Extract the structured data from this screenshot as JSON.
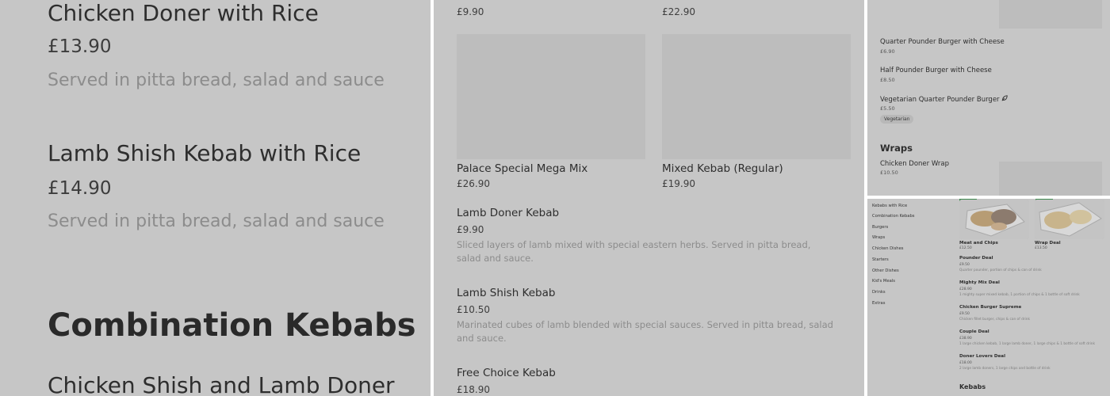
{
  "panel1": {
    "items": [
      {
        "name": "Chicken Doner with Rice",
        "price": "£13.90",
        "desc": "Served in pitta bread, salad and sauce"
      },
      {
        "name": "Lamb Shish Kebab with Rice",
        "price": "£14.90",
        "desc": "Served in pitta bread, salad and sauce"
      }
    ],
    "section_heading": "Combination Kebabs",
    "next_item": "Chicken Shish and Lamb Doner"
  },
  "panel2": {
    "top_prices": [
      "£9.90",
      "£22.90"
    ],
    "cards": [
      {
        "name": "Palace Special Mega Mix",
        "price": "£26.90"
      },
      {
        "name": "Mixed Kebab (Regular)",
        "price": "£19.90"
      }
    ],
    "items": [
      {
        "name": "Lamb Doner Kebab",
        "price": "£9.90",
        "desc": "Sliced layers of lamb mixed with special eastern herbs. Served in pitta bread, salad and sauce."
      },
      {
        "name": "Lamb Shish Kebab",
        "price": "£10.50",
        "desc": "Marinated cubes of lamb blended with special sauces. Served in pitta bread, salad and sauce."
      },
      {
        "name": "Free Choice Kebab",
        "price": "£18.90"
      }
    ]
  },
  "panel3": {
    "items": [
      {
        "name": "Quarter Pounder Burger with Cheese",
        "price": "£6.90"
      },
      {
        "name": "Half Pounder Burger with Cheese",
        "price": "£8.50"
      },
      {
        "name": "Vegetarian Quarter Pounder Burger",
        "price": "£5.50",
        "tag": "Vegetarian",
        "icon": "leaf-icon"
      }
    ],
    "section_heading": "Wraps",
    "wrap_item": {
      "name": "Chicken Doner Wrap",
      "price": "£10.50"
    }
  },
  "panel4": {
    "sidebar": [
      "Kebabs with Rice",
      "Combination Kebabs",
      "Burgers",
      "Wraps",
      "Chicken Dishes",
      "Starters",
      "Other Dishes",
      "Kid's Meals",
      "Drinks",
      "Extras"
    ],
    "cards": [
      {
        "name": "Meat and Chips",
        "price": "£12.50"
      },
      {
        "name": "Wrap Deal",
        "price": "£13.50"
      }
    ],
    "deals": [
      {
        "name": "Pounder Deal",
        "price": "£9.50",
        "desc": "Quarter pounder, portion of chips & can of drink"
      },
      {
        "name": "Mighty Mix Deal",
        "price": "£28.90",
        "desc": "1 mighty super mixed kebab, 1 portion of chips & 1 bottle of soft drink"
      },
      {
        "name": "Chicken Burger Supreme",
        "price": "£9.50",
        "desc": "Chicken fillet burger, chips & can of drink"
      },
      {
        "name": "Couple Deal",
        "price": "£38.90",
        "desc": "1 large chicken kebab, 1 large lamb doner, 1 large chips & 1 bottle of soft drink"
      },
      {
        "name": "Doner Lovers Deal",
        "price": "£18.00",
        "desc": "2 large lamb doners, 1 large chips and bottle of drink"
      }
    ],
    "section_heading": "Kebabs"
  },
  "colors": {
    "backdrop": "#c6c6c6",
    "image_placeholder": "#bdbdbd",
    "accent_green": "#3d8a4e"
  }
}
